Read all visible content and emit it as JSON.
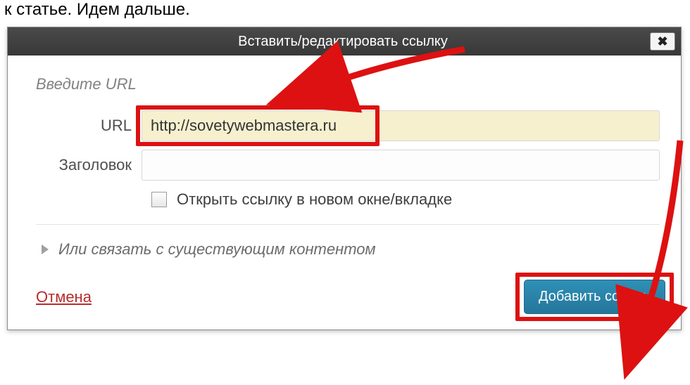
{
  "page": {
    "text_above": "к статье. Идем дальше.",
    "text_below": " "
  },
  "dialog": {
    "title": "Вставить/редактировать ссылку",
    "section_heading": "Введите URL",
    "url_label": "URL",
    "url_value": "http://sovetywebmastera.ru",
    "title_label": "Заголовок",
    "title_value": "",
    "new_tab_label": "Открыть ссылку в новом окне/вкладке",
    "link_existing": "Или связать с существующим контентом",
    "cancel": "Отмена",
    "submit": "Добавить ссылку"
  }
}
